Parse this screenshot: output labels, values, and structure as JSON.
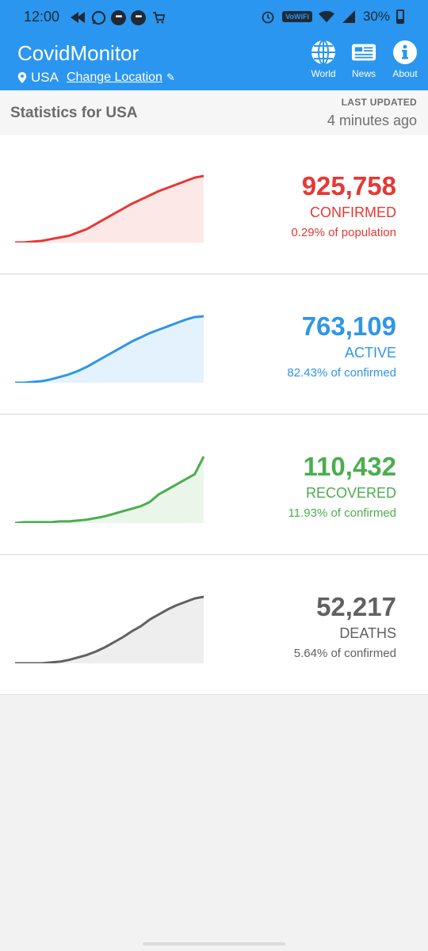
{
  "status_bar": {
    "time": "12:00",
    "wifi_badge": "VoWiFi",
    "battery": "30%"
  },
  "app": {
    "title": "CovidMonitor",
    "location": "USA",
    "change_location": "Change Location",
    "nav": [
      {
        "label": "World",
        "icon": "globe-icon"
      },
      {
        "label": "News",
        "icon": "newspaper-icon"
      },
      {
        "label": "About",
        "icon": "info-icon"
      }
    ]
  },
  "stats": {
    "title": "Statistics for USA",
    "last_updated_label": "LAST UPDATED",
    "last_updated_value": "4 minutes ago"
  },
  "colors": {
    "primary": "#2b96ef",
    "confirmed": "#e53935",
    "active": "#2f96e6",
    "recovered": "#4cad4f",
    "deaths": "#616161"
  },
  "cards": [
    {
      "key": "confirmed",
      "value": "925,758",
      "label": "CONFIRMED",
      "sub": "0.29% of population",
      "color": "#e53935",
      "fill": "#fde8e8",
      "series": [
        0,
        0,
        1,
        2,
        4,
        6,
        8,
        12,
        16,
        22,
        28,
        34,
        40,
        46,
        51,
        56,
        61,
        65,
        69,
        73,
        77,
        79
      ]
    },
    {
      "key": "active",
      "value": "763,109",
      "label": "ACTIVE",
      "sub": "82.43% of confirmed",
      "color": "#2f96e6",
      "fill": "#e4f2fd",
      "series": [
        0,
        0,
        1,
        2,
        4,
        7,
        10,
        14,
        19,
        25,
        31,
        37,
        43,
        49,
        54,
        59,
        63,
        67,
        71,
        75,
        78,
        79
      ]
    },
    {
      "key": "recovered",
      "value": "110,432",
      "label": "RECOVERED",
      "sub": "11.93% of confirmed",
      "color": "#4cad4f",
      "fill": "#ebf6eb",
      "series": [
        0,
        1,
        1,
        1,
        1,
        2,
        2,
        3,
        4,
        6,
        8,
        11,
        14,
        17,
        20,
        25,
        34,
        40,
        46,
        52,
        58,
        79
      ]
    },
    {
      "key": "deaths",
      "value": "52,217",
      "label": "DEATHS",
      "sub": "5.64% of confirmed",
      "color": "#616161",
      "fill": "#eeeeee",
      "series": [
        0,
        0,
        0,
        0,
        1,
        2,
        4,
        7,
        10,
        14,
        19,
        25,
        31,
        38,
        44,
        52,
        58,
        64,
        69,
        73,
        77,
        79
      ]
    }
  ]
}
